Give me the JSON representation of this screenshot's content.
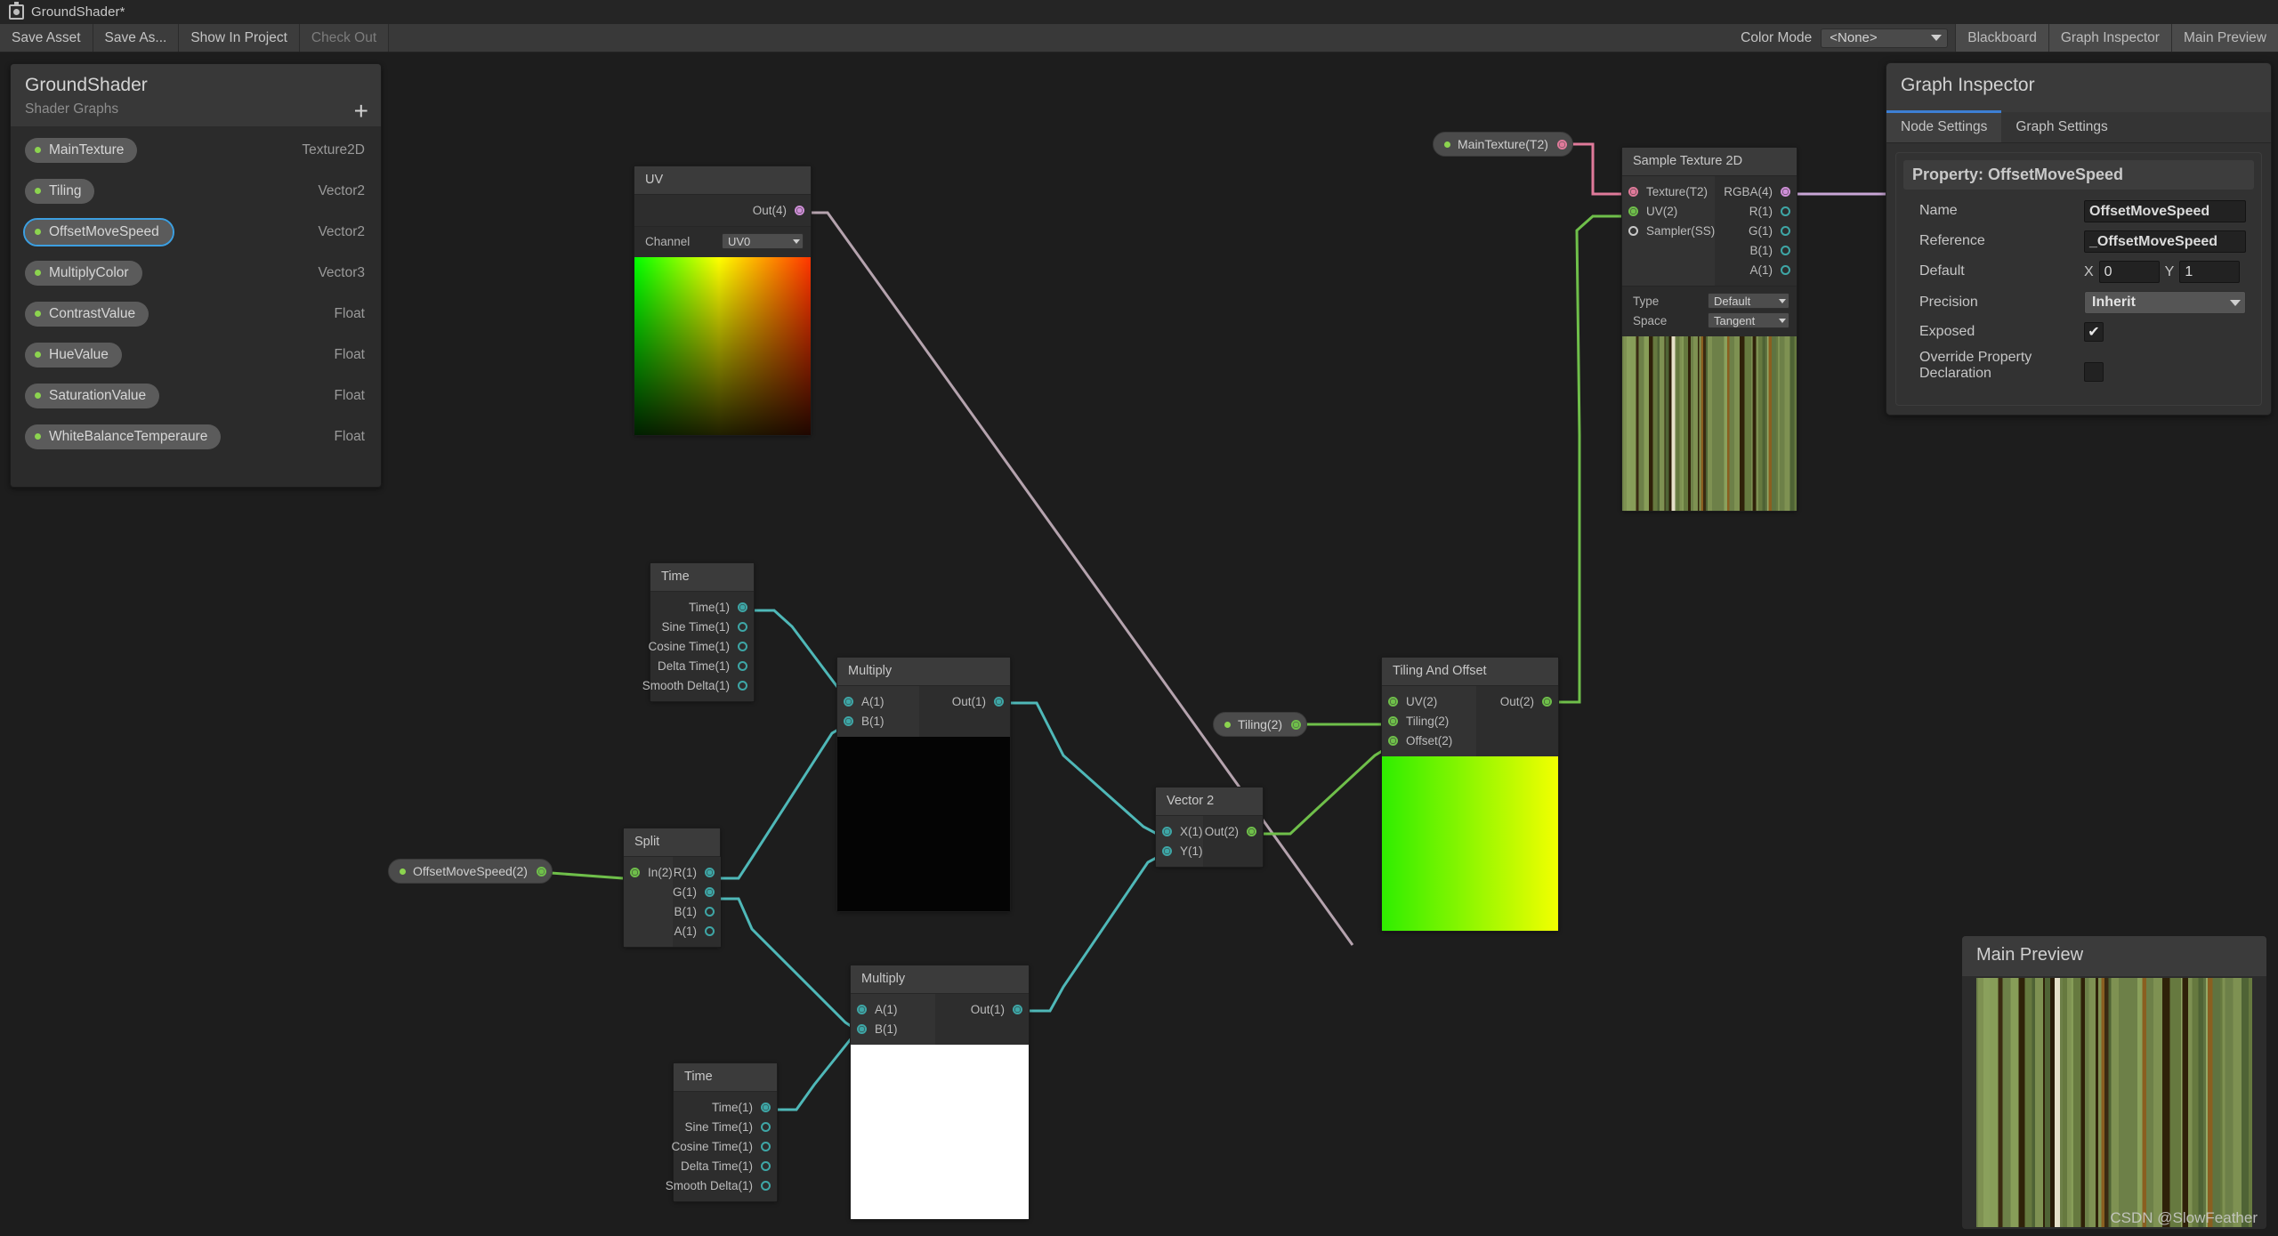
{
  "window": {
    "title": "GroundShader*",
    "icon": "shader-graph-icon"
  },
  "toolbar": {
    "buttons": [
      {
        "label": "Save Asset",
        "enabled": true
      },
      {
        "label": "Save As...",
        "enabled": true
      },
      {
        "label": "Show In Project",
        "enabled": true
      },
      {
        "label": "Check Out",
        "enabled": false
      }
    ],
    "color_mode_label": "Color Mode",
    "color_mode_value": "<None>",
    "toggles": [
      "Blackboard",
      "Graph Inspector",
      "Main Preview"
    ]
  },
  "blackboard": {
    "title": "GroundShader",
    "subtitle": "Shader Graphs",
    "add_label": "+",
    "properties": [
      {
        "name": "MainTexture",
        "type": "Texture2D",
        "selected": false
      },
      {
        "name": "Tiling",
        "type": "Vector2",
        "selected": false
      },
      {
        "name": "OffsetMoveSpeed",
        "type": "Vector2",
        "selected": true
      },
      {
        "name": "MultiplyColor",
        "type": "Vector3",
        "selected": false
      },
      {
        "name": "ContrastValue",
        "type": "Float",
        "selected": false
      },
      {
        "name": "HueValue",
        "type": "Float",
        "selected": false
      },
      {
        "name": "SaturationValue",
        "type": "Float",
        "selected": false
      },
      {
        "name": "WhiteBalanceTemperaure",
        "type": "Float",
        "selected": false
      }
    ]
  },
  "inspector": {
    "title": "Graph Inspector",
    "tabs": [
      {
        "label": "Node Settings",
        "active": true
      },
      {
        "label": "Graph Settings",
        "active": false
      }
    ],
    "property_header": "Property: OffsetMoveSpeed",
    "fields": {
      "name_label": "Name",
      "name_value": "OffsetMoveSpeed",
      "reference_label": "Reference",
      "reference_value": "_OffsetMoveSpeed",
      "default_label": "Default",
      "default_x_axis": "X",
      "default_x_value": "0",
      "default_y_axis": "Y",
      "default_y_value": "1",
      "precision_label": "Precision",
      "precision_value": "Inherit",
      "exposed_label": "Exposed",
      "exposed_checked": "✔",
      "override_label": "Override Property Declaration",
      "override_checked": ""
    }
  },
  "main_preview": {
    "title": "Main Preview",
    "watermark": "CSDN @SlowFeather"
  },
  "graph": {
    "nodes": {
      "uv": {
        "title": "UV",
        "out_port": "Out(4)",
        "setting_label": "Channel",
        "setting_value": "UV0"
      },
      "sample_texture": {
        "title": "Sample Texture 2D",
        "inputs": [
          "Texture(T2)",
          "UV(2)",
          "Sampler(SS)"
        ],
        "outputs": [
          "RGBA(4)",
          "R(1)",
          "G(1)",
          "B(1)",
          "A(1)"
        ],
        "type_label": "Type",
        "type_value": "Default",
        "space_label": "Space",
        "space_value": "Tangent"
      },
      "time_top": {
        "title": "Time",
        "outputs": [
          "Time(1)",
          "Sine Time(1)",
          "Cosine Time(1)",
          "Delta Time(1)",
          "Smooth Delta(1)"
        ]
      },
      "time_bottom": {
        "title": "Time",
        "outputs": [
          "Time(1)",
          "Sine Time(1)",
          "Cosine Time(1)",
          "Delta Time(1)",
          "Smooth Delta(1)"
        ]
      },
      "multiply_top": {
        "title": "Multiply",
        "inputs": [
          "A(1)",
          "B(1)"
        ],
        "outputs": [
          "Out(1)"
        ]
      },
      "multiply_bottom": {
        "title": "Multiply",
        "inputs": [
          "A(1)",
          "B(1)"
        ],
        "outputs": [
          "Out(1)"
        ]
      },
      "split": {
        "title": "Split",
        "inputs": [
          "In(2)"
        ],
        "outputs": [
          "R(1)",
          "G(1)",
          "B(1)",
          "A(1)"
        ]
      },
      "vector2": {
        "title": "Vector 2",
        "inputs": [
          "X(1)",
          "Y(1)"
        ],
        "outputs": [
          "Out(2)"
        ]
      },
      "tiling_and_offset": {
        "title": "Tiling And Offset",
        "inputs": [
          "UV(2)",
          "Tiling(2)",
          "Offset(2)"
        ],
        "outputs": [
          "Out(2)"
        ]
      }
    },
    "property_nodes": {
      "main_texture": "MainTexture(T2)",
      "tiling": "Tiling(2)",
      "offset_move_speed": "OffsetMoveSpeed(2)"
    }
  },
  "colors": {
    "accent_blue": "#3d9fe0",
    "port_green": "#6fbf4a",
    "port_teal": "#3ea6a6",
    "port_pink": "#e07a9a",
    "property_dot": "#8cd44f",
    "window_bg": "#1d1d1d",
    "panel_bg": "#2b2b2b"
  }
}
